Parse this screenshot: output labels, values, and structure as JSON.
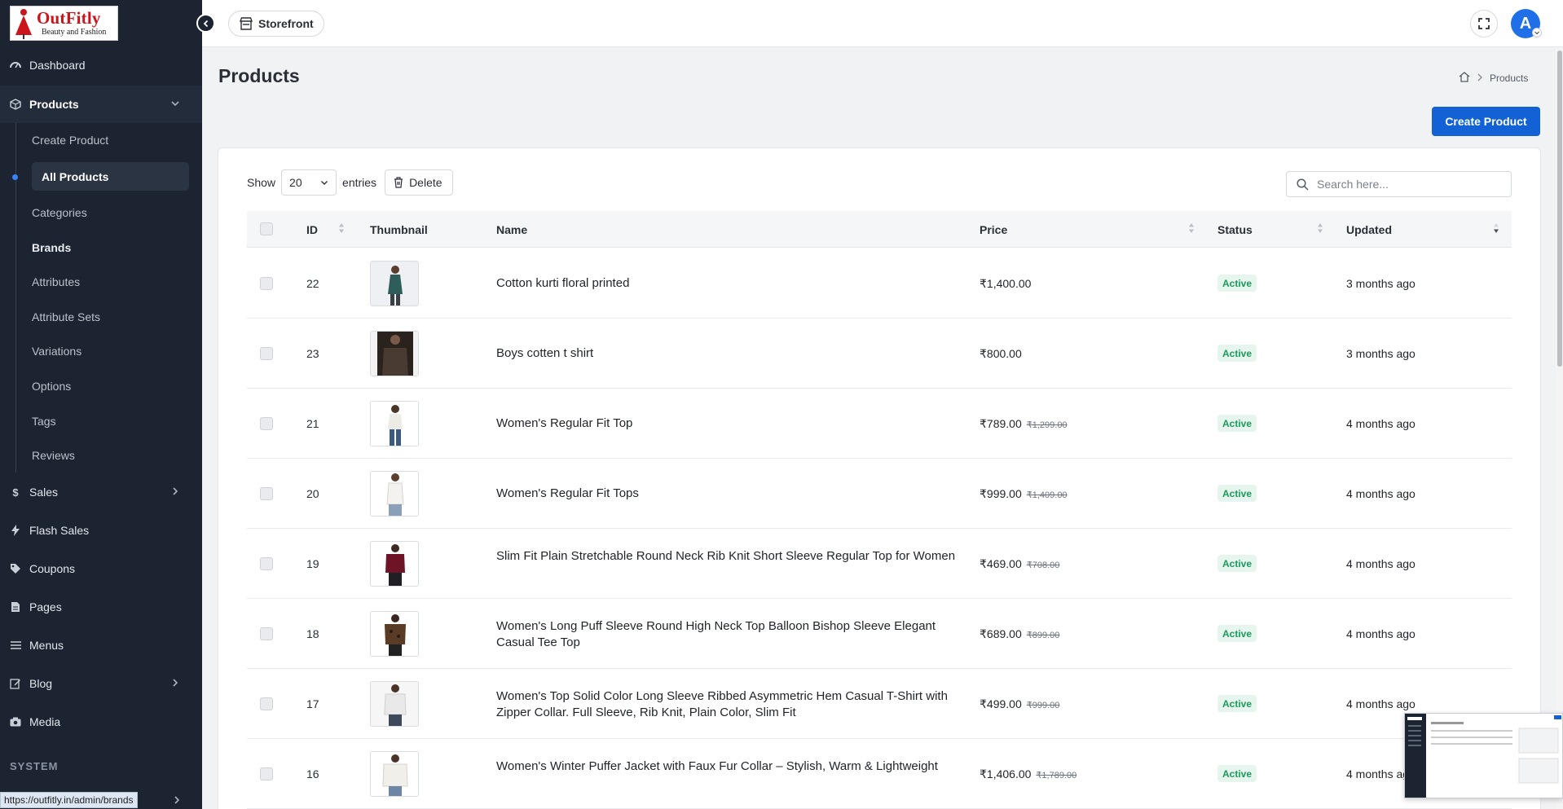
{
  "brand": {
    "name": "OutFitly",
    "tagline": "Beauty and Fashion"
  },
  "sidebar": {
    "dashboard": "Dashboard",
    "products": "Products",
    "products_children": [
      "Create Product",
      "All Products",
      "Categories",
      "Brands",
      "Attributes",
      "Attribute Sets",
      "Variations",
      "Options",
      "Tags",
      "Reviews"
    ],
    "sales": "Sales",
    "flash_sales": "Flash Sales",
    "coupons": "Coupons",
    "pages": "Pages",
    "menus": "Menus",
    "blog": "Blog",
    "media": "Media",
    "system_label": "SYSTEM"
  },
  "topbar": {
    "storefront_label": "Storefront",
    "avatar_initial": "A"
  },
  "page": {
    "title": "Products",
    "breadcrumb_current": "Products",
    "create_button": "Create Product"
  },
  "controls": {
    "show_label": "Show",
    "entries_value": "20",
    "entries_label": "entries",
    "delete_label": "Delete",
    "search_placeholder": "Search here..."
  },
  "table": {
    "headers": {
      "id": "ID",
      "thumbnail": "Thumbnail",
      "name": "Name",
      "price": "Price",
      "status": "Status",
      "updated": "Updated"
    },
    "rows": [
      {
        "id": "22",
        "name": "Cotton kurti floral printed",
        "price": "₹1,400.00",
        "old_price": "",
        "status": "Active",
        "updated": "3 months ago"
      },
      {
        "id": "23",
        "name": "Boys cotten t shirt",
        "price": "₹800.00",
        "old_price": "",
        "status": "Active",
        "updated": "3 months ago"
      },
      {
        "id": "21",
        "name": "Women's Regular Fit Top",
        "price": "₹789.00",
        "old_price": "₹1,299.00",
        "status": "Active",
        "updated": "4 months ago"
      },
      {
        "id": "20",
        "name": "Women's Regular Fit Tops",
        "price": "₹999.00",
        "old_price": "₹1,409.00",
        "status": "Active",
        "updated": "4 months ago"
      },
      {
        "id": "19",
        "name": "Slim Fit Plain Stretchable Round Neck Rib Knit Short Sleeve Regular Top for Women",
        "price": "₹469.00",
        "old_price": "₹708.00",
        "status": "Active",
        "updated": "4 months ago"
      },
      {
        "id": "18",
        "name": "Women's Long Puff Sleeve Round High Neck Top Balloon Bishop Sleeve Elegant Casual Tee Top",
        "price": "₹689.00",
        "old_price": "₹899.00",
        "status": "Active",
        "updated": "4 months ago"
      },
      {
        "id": "17",
        "name": "Women's Top Solid Color Long Sleeve Ribbed Asymmetric Hem Casual T-Shirt with Zipper Collar. Full Sleeve, Rib Knit, Plain Color, Slim Fit",
        "price": "₹499.00",
        "old_price": "₹999.00",
        "status": "Active",
        "updated": "4 months ago"
      },
      {
        "id": "16",
        "name": "Women's Winter Puffer Jacket with Faux Fur Collar – Stylish, Warm & Lightweight",
        "price": "₹1,406.00",
        "old_price": "₹1,789.00",
        "status": "Active",
        "updated": "4 months ago"
      }
    ]
  },
  "status_bar": {
    "url": "https://outfitly.in/admin/brands"
  },
  "colors": {
    "sidebar_bg": "#1c2431",
    "primary": "#1262d6",
    "active_green": "#1d9a5b",
    "brand_red": "#c9151b"
  }
}
